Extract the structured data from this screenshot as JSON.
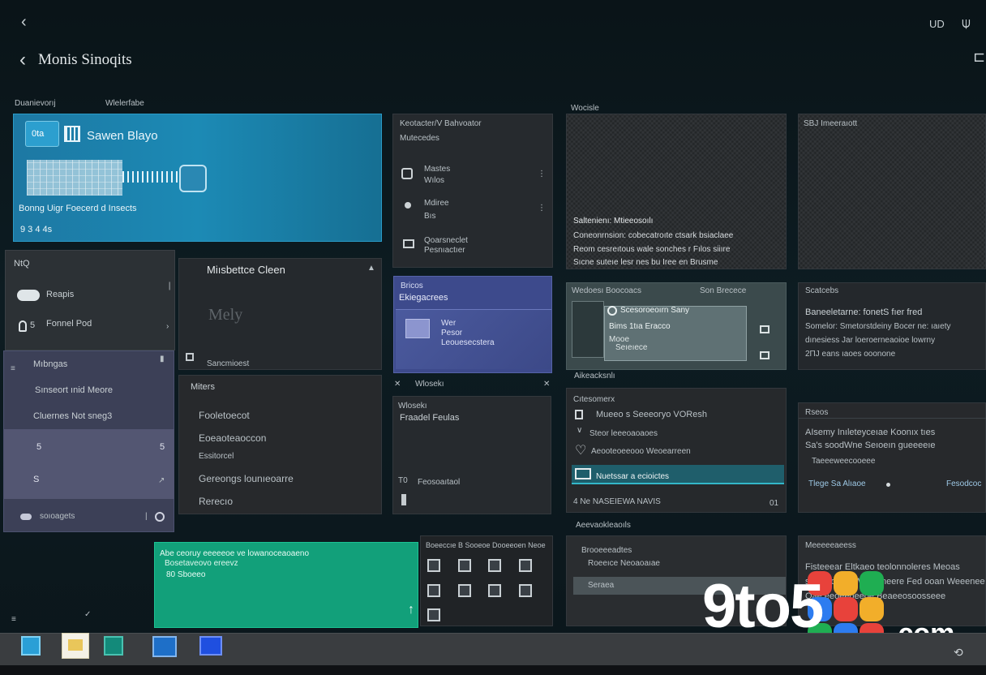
{
  "header": {
    "back_glyph": "‹",
    "title": "Monis Sinoqits",
    "status_text": "UD",
    "right_glyph": "⍦",
    "corner_glyph": "⊏"
  },
  "sections": {
    "left_label_1": "Duanievorıj",
    "left_label_2": "Wlelerfabe",
    "mid_label": "Wocisle",
    "right_top_label": "SBJ Imeeraıott",
    "row2_left_label": "Aikeacksnlı",
    "row3_label": "Aeevaokleaoıls"
  },
  "hero": {
    "badge": "0ta",
    "title": "Sawen Blayo",
    "subtitle": "Bonng Uigr Foecerd d Insects",
    "meta": "9 3 4 4s",
    "accent": "#1f8fbd"
  },
  "panel_a": {
    "header": "Keotacter/V Bahvoator",
    "subheader": "Mutecedes",
    "items": [
      {
        "title": "Mastes",
        "sub": "Wılos"
      },
      {
        "title": "Mdiree",
        "sub": "Bıs"
      },
      {
        "title": "Qoarsneclet",
        "sub": "Pesnıactıer"
      }
    ]
  },
  "news_card": {
    "title": "Saltenienı: Mtieeosoılı",
    "lines": [
      "Coneonrnsion: cobecatroıte ctsark bsiaclaee",
      "Reom cesreıtous wale sonches r Fılos siiıre",
      "Sıcne suteıe lesr nes bu Iree en Brusme"
    ]
  },
  "sidebar_card_1": {
    "title": "NtQ",
    "items": [
      "Reapis",
      "Fonnel Pod"
    ],
    "item_prefix": "5"
  },
  "mid_card": {
    "title": "Miısbettce Cleen",
    "watermark": "Mely",
    "footer": "Sancmioest"
  },
  "blue_card": {
    "label": "Bricos",
    "title": "Ekiegacrees",
    "lines": [
      "Wer",
      "Pesor",
      "Leouesecstera"
    ]
  },
  "media_card": {
    "header_left": "Wedoesı Boocoacs",
    "header_right": "Son Brecece",
    "title": "Scesoroeoırn Sany",
    "line": "Bims 1tıa Eracco",
    "small": "Mooe",
    "footer": "Seıeıece"
  },
  "text_card_right": {
    "label": "Scatcebs",
    "lines": [
      "Baneeletarne: fonetS fıer fred",
      "Somelor: Smetorstdeiny Bocer ne: ıaıety",
      "dınesiess Jar loeroerneaoioe lowrny",
      "2ПЈ eans ıaoes ooonone"
    ]
  },
  "sidebar_card_2": {
    "title": "Mıbngas",
    "items": [
      "Sınseort ınid Meore",
      "Cluernes Not sneg3"
    ],
    "row_icons": [
      "5",
      "S"
    ],
    "footer": "soıoagets"
  },
  "list_card": {
    "title": "Miters",
    "items": [
      "Fooletoecot",
      "Eoeaoteaoccon",
      "Essitorcel",
      "Gereongs lounıeoarre",
      "Rerecıo"
    ]
  },
  "features_card": {
    "label": "Wlosekı",
    "title": "Fraadel Feulas",
    "footer_num": "T0",
    "footer": "Feosoaıtaol"
  },
  "check_card": {
    "label": "Cıtesomerx",
    "items": [
      "Mueeo s Seeeoryo VOResh",
      "Steor leeeoaoaoes",
      "Aeooteoeeooo Weoearreen",
      "Nuetssar a ecioictes"
    ],
    "footer": "4 Ne NASEIEWA NAVIS",
    "footer_right": "01"
  },
  "settings_card_right": {
    "label": "Rseos",
    "lines": [
      "AIsemy Inıleteyceıae Koonıx tıes",
      "Sa's soodWne Seıoeın gueeeeıe"
    ],
    "foot": "Taeeeweecooeee",
    "link_left": "Tlege Sa Alıaoe",
    "link_right": "Fesodcoc"
  },
  "green_card": {
    "title": "Abe ceoruy eeeeeoe ve lowanoceaoaeno",
    "sub": "Bosetaveovo ereevz",
    "footer": "80 Sboeeo",
    "accent": "#13a07a"
  },
  "grid_card": {
    "header": "Boeeccıe B Sooeoe Dooeeoen Neoe",
    "icons": [
      "doc-icon",
      "folder-icon",
      "screen-icon",
      "photo-icon",
      "file-icon",
      "edit-icon",
      "image-icon",
      "save-icon",
      "media-icon",
      "empty",
      "empty",
      "empty"
    ]
  },
  "video_card": {
    "label": "Brooeeeadtes",
    "title": "Roeeıce Neoaoaıae",
    "bar": "Seraea"
  },
  "bottom_right_card": {
    "label": "Meeeeeaeess",
    "lines": [
      "Fisteeear Eltkaeo teolonnoleres Meoas",
      "scenniq BoeWeel sneere Fed ooan Weeenee",
      "Qae eeoeeoeeoe Beaeeosoosseee"
    ]
  },
  "watermark": {
    "brand": "9to5",
    "suffix": ".com"
  },
  "taskbar": {
    "apps": [
      "store-icon",
      "folder-icon",
      "chat-icon",
      "settings-icon",
      "mail-icon"
    ],
    "tray_glyph": "⟲"
  }
}
